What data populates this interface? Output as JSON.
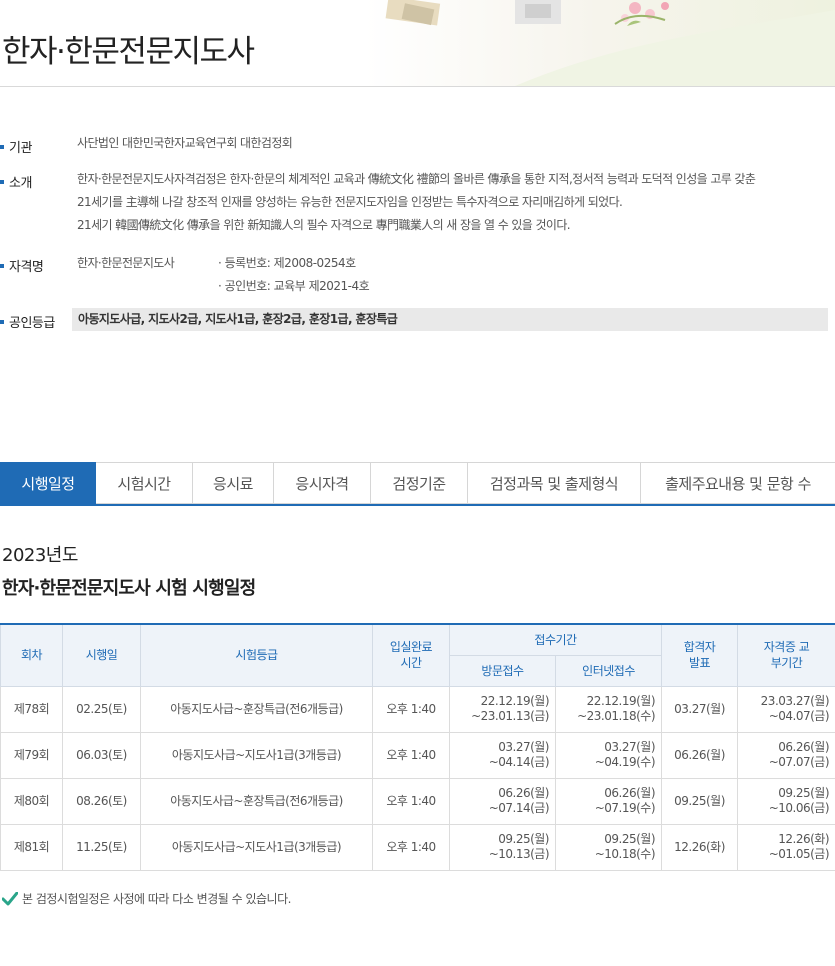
{
  "page_title": "한자·한문전문지도사",
  "info": {
    "org_label": "기관",
    "org_value": "사단법인 대한민국한자교육연구회 대한검정회",
    "intro_label": "소개",
    "intro_lines": [
      "한자·한문전문지도사자격검정은 한자·한문의 체계적인 교육과 傳統文化 禮節의 올바른 傳承을 통한 지적,정서적 능력과 도덕적 인성을 고루 갖춘",
      "21세기를 主導해 나갈 창조적 인재를 양성하는 유능한 전문지도자임을 인정받는 특수자격으로 자리매김하게 되었다.",
      "21세기 韓國傳統文化 傳承을 위한 新知識人의 필수 자격으로 專門職業人의 새 장을 열 수 있을 것이다."
    ],
    "cert_label": "자격명",
    "cert_name": "한자·한문전문지도사",
    "reg_no": "· 등록번호: 제2008-0254호",
    "approval_no": "· 공인번호: 교육부 제2021-4호",
    "grade_label": "공인등급",
    "grade_value": "아동지도사급, 지도사2급, 지도사1급, 훈장2급, 훈장1급, 훈장특급"
  },
  "tabs": [
    "시행일정",
    "시험시간",
    "응시료",
    "응시자격",
    "검정기준",
    "검정과목 및 출제형식",
    "출제주요내용 및 문항 수"
  ],
  "active_tab": 0,
  "year": "2023년도",
  "schedule_title": "한자·한문전문지도사 시험 시행일정",
  "table": {
    "headers": {
      "round": "회차",
      "exam_date": "시행일",
      "grade": "시험등급",
      "entry_time": "입실완료 시간",
      "reception": "접수기간",
      "visit": "방문접수",
      "internet": "인터넷접수",
      "announce": "합격자 발표",
      "issue": "자격증 교부기간"
    },
    "rows": [
      {
        "round": "제78회",
        "date": "02.25(토)",
        "grade": "아동지도사급~훈장특급(전6개등급)",
        "time": "오후 1:40",
        "visit_1": "22.12.19(월)",
        "visit_2": "~23.01.13(금)",
        "net_1": "22.12.19(월)",
        "net_2": "~23.01.18(수)",
        "announce": "03.27(월)",
        "issue_1": "23.03.27(월)",
        "issue_2": "~04.07(금)"
      },
      {
        "round": "제79회",
        "date": "06.03(토)",
        "grade": "아동지도사급~지도사1급(3개등급)",
        "time": "오후 1:40",
        "visit_1": "03.27(월)",
        "visit_2": "~04.14(금)",
        "net_1": "03.27(월)",
        "net_2": "~04.19(수)",
        "announce": "06.26(월)",
        "issue_1": "06.26(월)",
        "issue_2": "~07.07(금)"
      },
      {
        "round": "제80회",
        "date": "08.26(토)",
        "grade": "아동지도사급~훈장특급(전6개등급)",
        "time": "오후 1:40",
        "visit_1": "06.26(월)",
        "visit_2": "~07.14(금)",
        "net_1": "06.26(월)",
        "net_2": "~07.19(수)",
        "announce": "09.25(월)",
        "issue_1": "09.25(월)",
        "issue_2": "~10.06(금)"
      },
      {
        "round": "제81회",
        "date": "11.25(토)",
        "grade": "아동지도사급~지도사1급(3개등급)",
        "time": "오후 1:40",
        "visit_1": "09.25(월)",
        "visit_2": "~10.13(금)",
        "net_1": "09.25(월)",
        "net_2": "~10.18(수)",
        "announce": "12.26(화)",
        "issue_1": "12.26(화)",
        "issue_2": "~01.05(금)"
      }
    ]
  },
  "note": "본 검정시험일정은 사정에 따라 다소 변경될 수 있습니다.",
  "colors": {
    "accent": "#1f6bb5",
    "note_check": "#2aa58a"
  }
}
